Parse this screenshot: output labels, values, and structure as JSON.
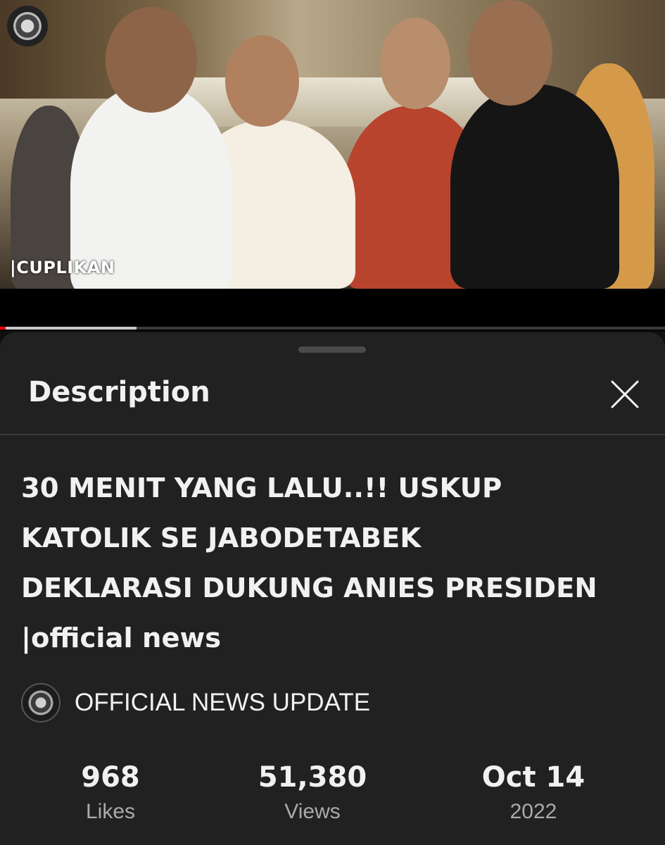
{
  "video": {
    "overlay_label": "|CUPLIKAN",
    "progress_fraction": 0.205
  },
  "description_panel": {
    "title": "Description",
    "close_icon": "close-icon"
  },
  "video_title": "30 MENIT YANG LALU..!! USKUP\nKATOLIK SE JABODETABEK\nDEKLARASI DUKUNG ANIES PRESIDEN\n|official news",
  "channel": {
    "name": "OFFICIAL NEWS UPDATE",
    "avatar_icon": "channel-avatar"
  },
  "stats": {
    "likes": {
      "value": "968",
      "label": "Likes"
    },
    "views": {
      "value": "51,380",
      "label": "Views"
    },
    "date": {
      "value": "Oct 14",
      "label": "2022"
    }
  },
  "colors": {
    "background": "#0f0f0f",
    "sheet": "#212121",
    "progress_played": "#ff0000",
    "secondary_text": "#aaaaaa"
  }
}
